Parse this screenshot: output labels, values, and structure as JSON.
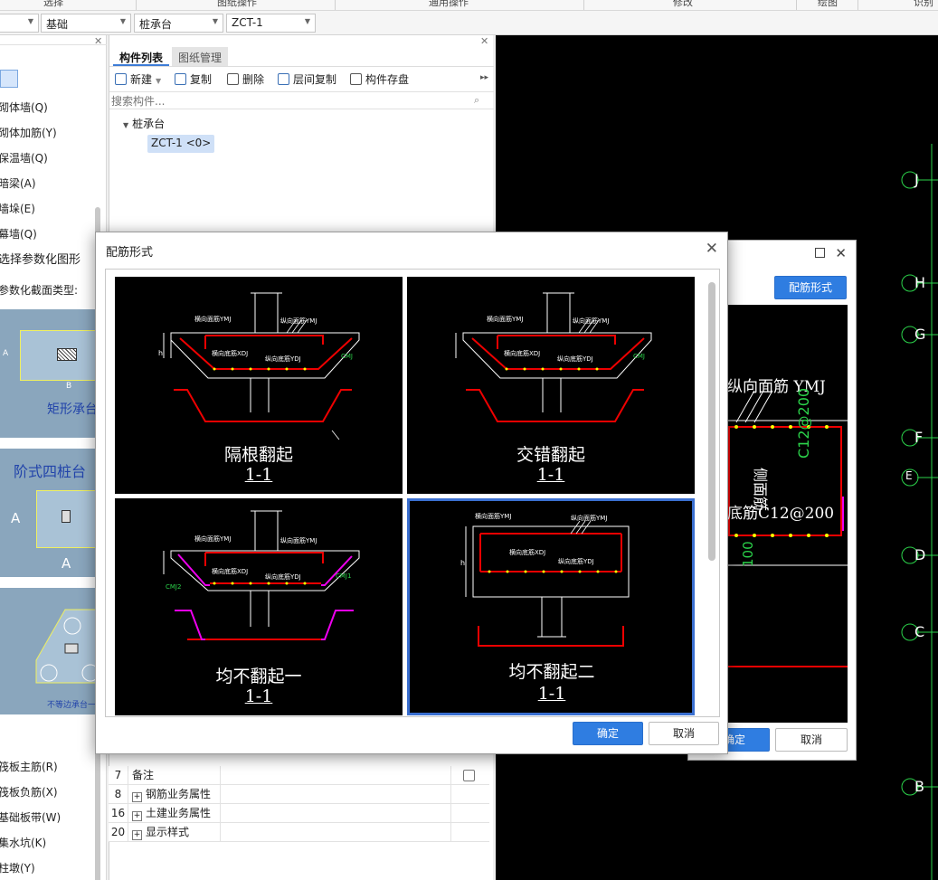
{
  "ribbon": {
    "items": [
      "选择",
      "图纸操作",
      "通用操作",
      "修改",
      "绘图",
      "识别"
    ]
  },
  "toolbar": {
    "selects": [
      "",
      "基础",
      "桩承台",
      "ZCT-1"
    ]
  },
  "left_nav": {
    "items": [
      "砌体墙(Q)",
      "砌体加筋(Y)",
      "保温墙(Q)",
      "暗梁(A)",
      "墙垛(E)",
      "幕墙(Q)"
    ],
    "bottom_items": [
      "筏板主筋(R)",
      "筏板负筋(X)",
      "基础板带(W)",
      "集水坑(K)",
      "柱墩(Y)"
    ]
  },
  "param_panel": {
    "title": "选择参数化图形",
    "subtitle": "参数化截面类型:",
    "cards": [
      {
        "caption": "矩形承台",
        "dim_a": "A",
        "dim_b": "B"
      },
      {
        "caption": "阶式四桩台",
        "dim_a": "A",
        "dim_b": "A"
      },
      {
        "caption": "不等边承台一"
      }
    ]
  },
  "component_list": {
    "tabs": [
      "构件列表",
      "图纸管理"
    ],
    "actions": [
      "新建",
      "复制",
      "删除",
      "层间复制",
      "构件存盘"
    ],
    "search_placeholder": "搜索构件...",
    "tree_root": "桩承台",
    "tree_child": "ZCT-1 <0>"
  },
  "properties": [
    {
      "no": "7",
      "name": "备注",
      "expandable": false
    },
    {
      "no": "8",
      "name": "钢筋业务属性",
      "expandable": true
    },
    {
      "no": "16",
      "name": "土建业务属性",
      "expandable": true
    },
    {
      "no": "20",
      "name": "显示样式",
      "expandable": true
    }
  ],
  "secondary_dialog": {
    "button": "配筋形式",
    "texts": [
      "纵向面筋 YMJ",
      "侧面筋",
      "C12@200",
      "底筋C12@200",
      "100"
    ],
    "ok": "确定",
    "cancel": "取消"
  },
  "axis_labels": [
    "J",
    "H",
    "G",
    "F",
    "E",
    "D",
    "C",
    "B"
  ],
  "dialog": {
    "title": "配筋形式",
    "options": [
      {
        "caption": "隔根翻起",
        "section": "1-1",
        "selected": false
      },
      {
        "caption": "交错翻起",
        "section": "1-1",
        "selected": false
      },
      {
        "caption": "均不翻起一",
        "section": "1-1",
        "selected": false
      },
      {
        "caption": "均不翻起二",
        "section": "1-1",
        "selected": true
      }
    ],
    "drawing_labels": {
      "hmj": "横向面筋YMJ",
      "zmj": "纵向面筋YMJ",
      "hdj": "横向底筋XDJ",
      "zdj": "纵向底筋YDJ",
      "cmj": "CMJ",
      "cmj1": "CMJ1",
      "cmj2": "CMJ2",
      "side": "侧面筋",
      "h": "h"
    },
    "ok": "确定",
    "cancel": "取消"
  }
}
